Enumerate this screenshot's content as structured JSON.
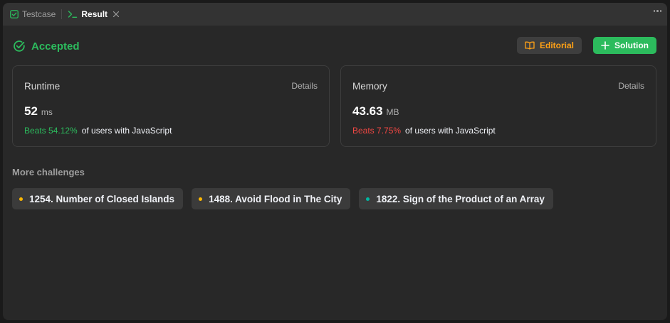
{
  "colors": {
    "accent_green": "#2cbb5d",
    "accent_orange": "#ffa116",
    "accent_red": "#ef4743",
    "difficulty_medium": "#ffb800",
    "difficulty_easy": "#00b8a3"
  },
  "tabs": [
    {
      "label": "Testcase",
      "icon": "checkbox-icon",
      "active": false
    },
    {
      "label": "Result",
      "icon": "terminal-prompt-icon",
      "active": true
    }
  ],
  "status": {
    "label": "Accepted",
    "icon": "check-circle-icon"
  },
  "actions": {
    "editorial_label": "Editorial",
    "editorial_icon": "book-icon",
    "solution_label": "Solution",
    "solution_icon": "plus-icon"
  },
  "runtime": {
    "title": "Runtime",
    "details_label": "Details",
    "value": "52",
    "unit": "ms",
    "beats": "Beats 54.12%",
    "suffix": "of users with JavaScript"
  },
  "memory": {
    "title": "Memory",
    "details_label": "Details",
    "value": "43.63",
    "unit": "MB",
    "beats": "Beats 7.75%",
    "suffix": "of users with JavaScript"
  },
  "more_challenges": {
    "title": "More challenges",
    "items": [
      {
        "label": "1254. Number of Closed Islands",
        "difficulty": "medium"
      },
      {
        "label": "1488. Avoid Flood in The City",
        "difficulty": "medium"
      },
      {
        "label": "1822. Sign of the Product of an Array",
        "difficulty": "easy"
      }
    ]
  }
}
